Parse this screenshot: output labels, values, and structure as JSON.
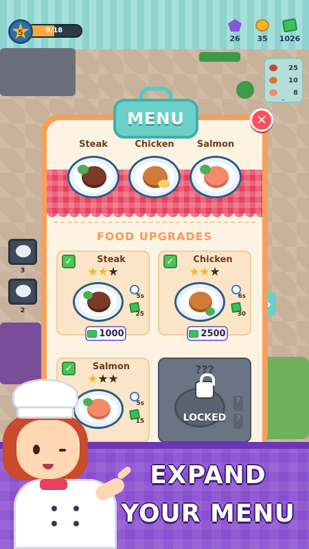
{
  "hud": {
    "level": "5",
    "xp_text": "9/18",
    "xp_fraction": 0.5,
    "currencies": [
      {
        "icon": "gem-icon",
        "value": "26",
        "color": "#8a55d6"
      },
      {
        "icon": "coin-icon",
        "value": "35",
        "color": "#f2b22f"
      },
      {
        "icon": "cash-icon",
        "value": "1026",
        "color": "#3fbf5b"
      }
    ],
    "stock": [
      {
        "icon": "steak-stock-icon",
        "value": "25",
        "color": "#c44a3a"
      },
      {
        "icon": "chicken-stock-icon",
        "value": "10",
        "color": "#d27a3a"
      },
      {
        "icon": "salmon-stock-icon",
        "value": "8",
        "color": "#f58a6a"
      }
    ]
  },
  "background_tables": [
    {
      "count": "3"
    },
    {
      "count": "2"
    }
  ],
  "menu": {
    "title": "MENU",
    "close_icon": "close-icon",
    "current_dishes": [
      {
        "name": "Steak",
        "food_color": "steak"
      },
      {
        "name": "Chicken",
        "food_color": "chicken"
      },
      {
        "name": "Salmon",
        "food_color": "salmon"
      }
    ],
    "upgrades_title": "FOOD UPGRADES",
    "upgrades": [
      {
        "name": "Steak",
        "stars_filled": 2,
        "stars_total": 3,
        "time": "5s",
        "profit": "25",
        "price": "1000"
      },
      {
        "name": "Chicken",
        "stars_filled": 2,
        "stars_total": 3,
        "time": "6s",
        "profit": "30",
        "price": "2500"
      },
      {
        "name": "Salmon",
        "stars_filled": 1,
        "stars_total": 3,
        "time": "5s",
        "profit": "15"
      }
    ],
    "locked": {
      "name": "???",
      "label": "LOCKED"
    },
    "next_icon": "chevron-right-icon"
  },
  "promo": {
    "line1": "EXPAND",
    "line2": "YOUR MENU"
  },
  "colors": {
    "accent_teal": "#6ad0c9",
    "modal_orange": "#f6a05a",
    "tablecloth_red": "#e8415e",
    "banner_purple": "#8a4fd0"
  }
}
